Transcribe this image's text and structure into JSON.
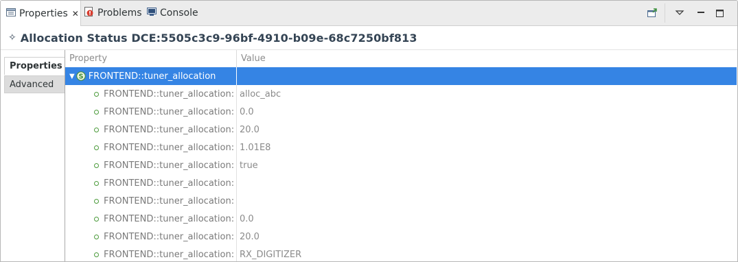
{
  "tabs": [
    {
      "label": "Properties",
      "icon": "properties-icon",
      "active": true,
      "closable": true
    },
    {
      "label": "Problems",
      "icon": "problems-icon",
      "active": false
    },
    {
      "label": "Console",
      "icon": "console-icon",
      "active": false
    }
  ],
  "toolbar": {
    "icons": [
      "pin-view-icon",
      "view-menu-chevron-icon",
      "minimize-icon",
      "maximize-icon"
    ]
  },
  "header": {
    "title": "Allocation Status DCE:5505c3c9-96bf-4910-b09e-68c7250bf813",
    "icon": "allocation-diamond-icon"
  },
  "side_tabs": [
    {
      "label": "Properties",
      "active": true
    },
    {
      "label": "Advanced",
      "active": false
    }
  ],
  "table": {
    "columns": [
      "Property",
      "Value"
    ],
    "root": {
      "label": "FRONTEND::tuner_allocation",
      "value": "",
      "expanded": true,
      "selected": true,
      "icon": "struct-s-icon"
    },
    "rows": [
      {
        "property": "FRONTEND::tuner_allocation:",
        "value": "alloc_abc"
      },
      {
        "property": "FRONTEND::tuner_allocation:",
        "value": "0.0"
      },
      {
        "property": "FRONTEND::tuner_allocation:",
        "value": "20.0"
      },
      {
        "property": "FRONTEND::tuner_allocation:",
        "value": "1.01E8"
      },
      {
        "property": "FRONTEND::tuner_allocation:",
        "value": "true"
      },
      {
        "property": "FRONTEND::tuner_allocation:",
        "value": ""
      },
      {
        "property": "FRONTEND::tuner_allocation:",
        "value": ""
      },
      {
        "property": "FRONTEND::tuner_allocation:",
        "value": "0.0"
      },
      {
        "property": "FRONTEND::tuner_allocation:",
        "value": "20.0"
      },
      {
        "property": "FRONTEND::tuner_allocation:",
        "value": "RX_DIGITIZER"
      }
    ]
  },
  "colors": {
    "selection": "#3584e4",
    "title": "#344454",
    "bullet": "#4a9a3a"
  }
}
